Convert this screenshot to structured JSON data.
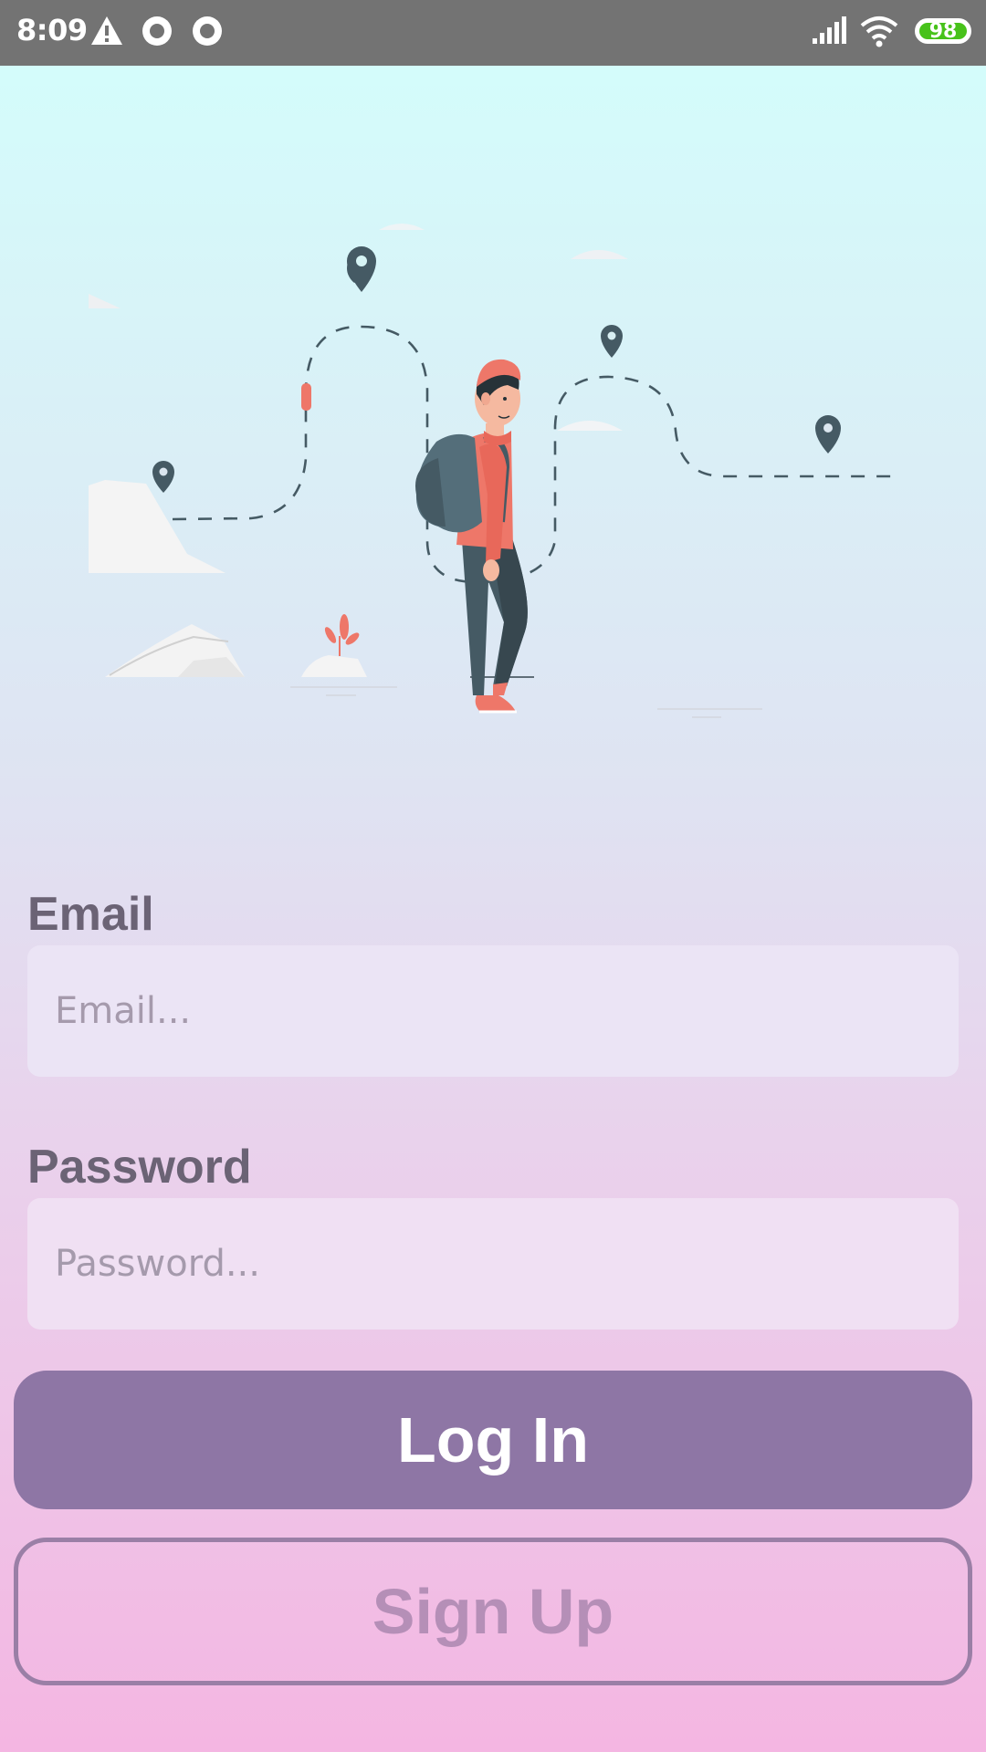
{
  "status_bar": {
    "time": "8:09",
    "battery_level": "98",
    "icons": [
      "warning-icon",
      "record-icon",
      "record-icon",
      "signal-icon",
      "wifi-icon",
      "battery-icon"
    ]
  },
  "illustration": {
    "subject": "hiker-with-backpack",
    "accent_color": "#ee7769",
    "pin_color": "#455a64"
  },
  "form": {
    "email_label": "Email",
    "email_placeholder": "Email...",
    "password_label": "Password",
    "password_placeholder": "Password..."
  },
  "actions": {
    "login_label": "Log In",
    "signup_label": "Sign Up"
  },
  "colors": {
    "primary": "#8e76a5",
    "label_text": "#6b6375",
    "status_bar": "#737373"
  }
}
